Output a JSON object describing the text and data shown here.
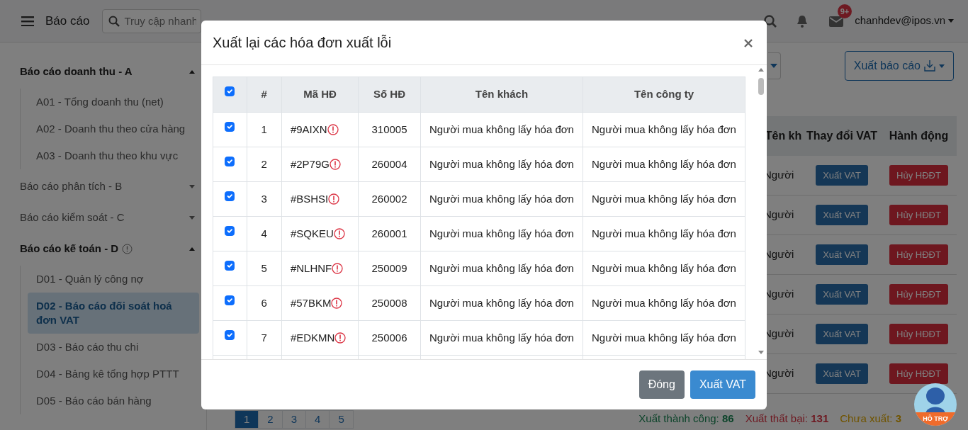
{
  "navbar": {
    "menu_label": "Báo cáo",
    "search": {
      "placeholder": "Truy cập nhanh"
    },
    "mail_badge": "9+",
    "user": "chanhdev@ipos.vn"
  },
  "sidebar": {
    "groups": [
      {
        "label": "Báo cáo doanh thu - A",
        "expanded": true,
        "info": false,
        "children": [
          {
            "label": "A01 - Tổng doanh thu (net)",
            "selected": false
          },
          {
            "label": "A02 - Doanh thu theo cửa hàng",
            "selected": false
          },
          {
            "label": "A03 - Doanh thu theo khu vực",
            "selected": false
          }
        ]
      },
      {
        "label": "Báo cáo phân tích - B",
        "expanded": false,
        "info": false
      },
      {
        "label": "Báo cáo kiểm soát - C",
        "expanded": false,
        "info": false
      },
      {
        "label": "Báo cáo kế toán - D",
        "expanded": true,
        "info": true,
        "children": [
          {
            "label": "D01 - Quản lý công nợ",
            "selected": false
          },
          {
            "label": "D02 - Báo cáo đối soát hoá đơn VAT",
            "selected": true
          },
          {
            "label": "D03 - Báo cáo thu chi",
            "selected": false
          },
          {
            "label": "D04 - Bảng kê tổng hợp PTTT",
            "selected": false
          },
          {
            "label": "D05 - Báo cáo bán hàng",
            "selected": false
          }
        ]
      }
    ]
  },
  "toolbar": {
    "export_button": "Xuất báo cáo"
  },
  "report_table": {
    "columns": [
      "Tên kh",
      "Thay đổi VAT",
      "Hành động"
    ],
    "rows": [
      {
        "customer": "Người",
        "vat_button": "Xuất VAT",
        "action_button": "Hủy HĐĐT"
      },
      {
        "customer": "Người",
        "vat_button": "Xuất VAT",
        "action_button": "Hủy HĐĐT"
      },
      {
        "customer": "Người",
        "vat_button": "Xuất VAT",
        "action_button": "Hủy HĐĐT"
      },
      {
        "customer": "Người",
        "vat_button": "Xuất VAT",
        "action_button": "Hủy HĐĐT"
      },
      {
        "customer": "Người",
        "vat_button": "Xuất VAT",
        "action_button": "Hủy HĐĐT"
      },
      {
        "customer": "Người",
        "vat_button": "Xuất VAT",
        "action_button": "Hủy HĐĐT"
      }
    ]
  },
  "pagination": [
    {
      "label": "1",
      "selected": true
    },
    {
      "label": "2",
      "selected": false
    },
    {
      "label": "3",
      "selected": false
    },
    {
      "label": "4",
      "selected": false
    },
    {
      "label": "5",
      "selected": false
    }
  ],
  "summary": [
    {
      "text": "Xuất thành công: **86**",
      "kind": "success"
    },
    {
      "text": "Xuất thất bại: **131**",
      "kind": "failed"
    },
    {
      "text": "Chưa xuất: **3**",
      "kind": "pending"
    }
  ],
  "support": {
    "label": "HỖ TRỢ"
  },
  "modal": {
    "title": "Xuất lại các hóa đơn xuất lỗi",
    "select_all_checked": true,
    "columns": [
      "#",
      "Mã HĐ",
      "Số HĐ",
      "Tên khách",
      "Tên công ty"
    ],
    "rows": [
      {
        "checked": true,
        "index": "1",
        "code": "#9AIXN",
        "error": true,
        "number": "310005",
        "customer": "Người mua không lấy hóa đơn",
        "company": "Người mua không lấy hóa đơn"
      },
      {
        "checked": true,
        "index": "2",
        "code": "#2P79G",
        "error": true,
        "number": "260004",
        "customer": "Người mua không lấy hóa đơn",
        "company": "Người mua không lấy hóa đơn"
      },
      {
        "checked": true,
        "index": "3",
        "code": "#BSHSI",
        "error": true,
        "number": "260002",
        "customer": "Người mua không lấy hóa đơn",
        "company": "Người mua không lấy hóa đơn"
      },
      {
        "checked": true,
        "index": "4",
        "code": "#SQKEU",
        "error": true,
        "number": "260001",
        "customer": "Người mua không lấy hóa đơn",
        "company": "Người mua không lấy hóa đơn"
      },
      {
        "checked": true,
        "index": "5",
        "code": "#NLHNF",
        "error": true,
        "number": "250009",
        "customer": "Người mua không lấy hóa đơn",
        "company": "Người mua không lấy hóa đơn"
      },
      {
        "checked": true,
        "index": "6",
        "code": "#57BKM",
        "error": true,
        "number": "250008",
        "customer": "Người mua không lấy hóa đơn",
        "company": "Người mua không lấy hóa đơn"
      },
      {
        "checked": true,
        "index": "7",
        "code": "#EDKMN",
        "error": true,
        "number": "250006",
        "customer": "Người mua không lấy hóa đơn",
        "company": "Người mua không lấy hóa đơn"
      }
    ],
    "buttons": [
      {
        "label": "Đóng",
        "kind": "secondary"
      },
      {
        "label": "Xuất VAT",
        "kind": "primary"
      }
    ]
  }
}
